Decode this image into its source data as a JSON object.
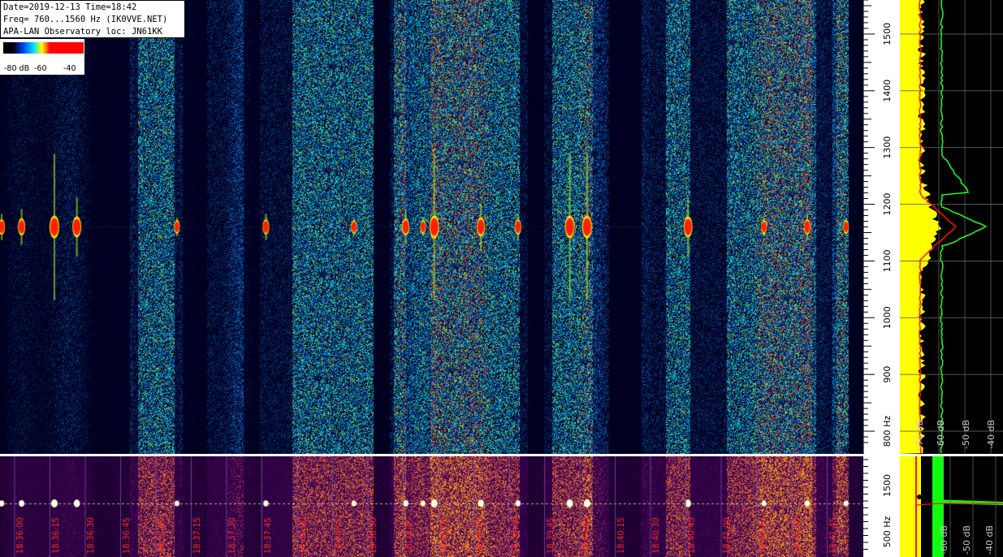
{
  "header": {
    "line1": "Date=2019-12-13 Time=18:42",
    "line2": "Freq= 760...1560 Hz (IK0VVE.NET)",
    "line3": "APA-LAN Observatory loc: JN61KK"
  },
  "legend": {
    "labels": [
      "-80 dB",
      "-60",
      "-40"
    ]
  },
  "freq_axis": {
    "ticks": [
      "1500",
      "1400",
      "1300",
      "1200",
      "1100",
      "1000",
      "900",
      "800 Hz"
    ]
  },
  "lower_axis": {
    "ticks": [
      "1500",
      "500 Hz"
    ]
  },
  "spectrum_axis": {
    "labels": [
      "-70 dB",
      "-60 dB",
      "-50 dB",
      "-40 dB"
    ]
  },
  "lower_spectrum_axis": {
    "labels": [
      "-60 dB",
      "-50 dB",
      "-40 dB"
    ]
  },
  "time_labels": [
    "18:36:00",
    "18:36:15",
    "18:36:30",
    "18:36:45",
    "18:37:00",
    "18:37:15",
    "18:37:30",
    "18:37:45",
    "18:38:00",
    "18:38:15",
    "18:38:30",
    "18:38:45",
    "18:39:00",
    "18:39:15",
    "18:39:30",
    "18:39:45",
    "18:40:00",
    "18:40:15",
    "18:40:30",
    "18:40:45",
    "18:41:00",
    "18:41:15",
    "18:41:30",
    "18:41:45"
  ],
  "chart_data": {
    "type": "heatmap",
    "title": "Date=2019-12-13 Time=18:42",
    "subtitle": "Freq= 760...1560 Hz (IK0VVE.NET)",
    "ylabel": "Hz",
    "ylim": [
      760,
      1560
    ],
    "color_scale_db": [
      -80,
      -40
    ],
    "carrier_hz": 1160,
    "meteor_echoes": [
      {
        "t": 0.002,
        "strength": 0.6
      },
      {
        "t": 0.025,
        "strength": 0.7
      },
      {
        "t": 0.063,
        "strength": 1.0
      },
      {
        "t": 0.089,
        "strength": 0.9
      },
      {
        "t": 0.205,
        "strength": 0.5
      },
      {
        "t": 0.308,
        "strength": 0.6
      },
      {
        "t": 0.41,
        "strength": 0.5
      },
      {
        "t": 0.47,
        "strength": 0.7
      },
      {
        "t": 0.49,
        "strength": 0.5
      },
      {
        "t": 0.503,
        "strength": 1.0
      },
      {
        "t": 0.557,
        "strength": 0.8
      },
      {
        "t": 0.6,
        "strength": 0.6
      },
      {
        "t": 0.66,
        "strength": 1.0
      },
      {
        "t": 0.68,
        "strength": 1.0
      },
      {
        "t": 0.797,
        "strength": 0.9
      },
      {
        "t": 0.885,
        "strength": 0.5
      },
      {
        "t": 0.935,
        "strength": 0.6
      },
      {
        "t": 0.98,
        "strength": 0.5
      }
    ]
  }
}
